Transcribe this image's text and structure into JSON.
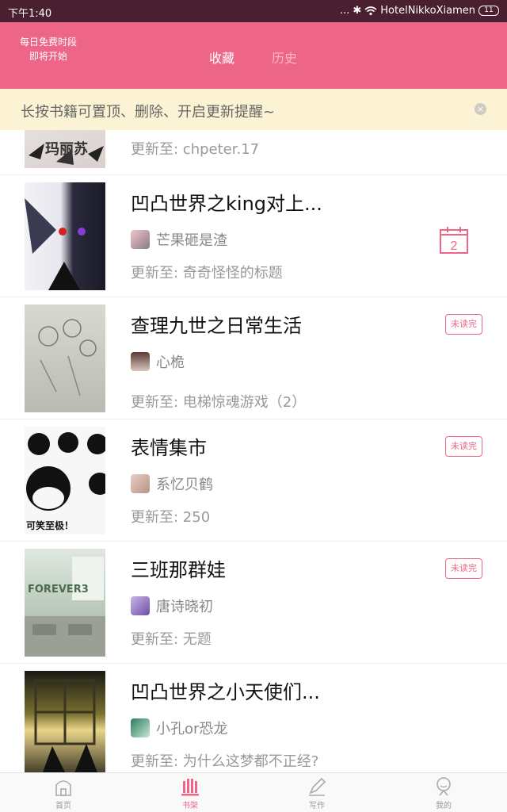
{
  "status_bar": {
    "time": "下午1:40",
    "dots": "...",
    "bt": "✱",
    "network": "HotelNikkoXiamen",
    "battery": "11"
  },
  "header": {
    "promo_line1": "每日免费时段",
    "promo_line2": "即将开始",
    "tab_favorites": "收藏",
    "tab_history": "历史",
    "accent_color": "#ee6687"
  },
  "notice": {
    "text": "长按书籍可置顶、删除、开启更新提醒~",
    "close_glyph": "×"
  },
  "books": [
    {
      "title": "",
      "author": "",
      "update_prefix": "更新至: ",
      "update": "chpeter.17",
      "badge": "",
      "cover_text": "玛丽苏"
    },
    {
      "title": "凹凸世界之king对上...",
      "author": "芒果砸是渣",
      "update_prefix": "更新至: ",
      "update": "奇奇怪怪的标题",
      "badge": "",
      "calendar": "2"
    },
    {
      "title": "查理九世之日常生活",
      "author": "心桅",
      "update_prefix": "更新至: ",
      "update": "电梯惊魂游戏（2）",
      "badge": "未读完"
    },
    {
      "title": "表情集市",
      "author": "系忆贝鹤",
      "update_prefix": "更新至: ",
      "update": "250",
      "badge": "未读完",
      "cover_text": "可笑至极！"
    },
    {
      "title": "三班那群娃",
      "author": "唐诗晓初",
      "update_prefix": "更新至: ",
      "update": "无题",
      "badge": "未读完",
      "cover_text": "FOREVER3"
    },
    {
      "title": "凹凸世界之小天使们...",
      "author": "小孔or恐龙",
      "update_prefix": "更新至: ",
      "update": "为什么这梦都不正经?",
      "badge": ""
    }
  ],
  "tabbar": [
    {
      "label": "首页",
      "icon": "home-icon"
    },
    {
      "label": "书架",
      "icon": "bookshelf-icon",
      "active": true
    },
    {
      "label": "写作",
      "icon": "pencil-icon"
    },
    {
      "label": "我的",
      "icon": "profile-icon"
    }
  ]
}
